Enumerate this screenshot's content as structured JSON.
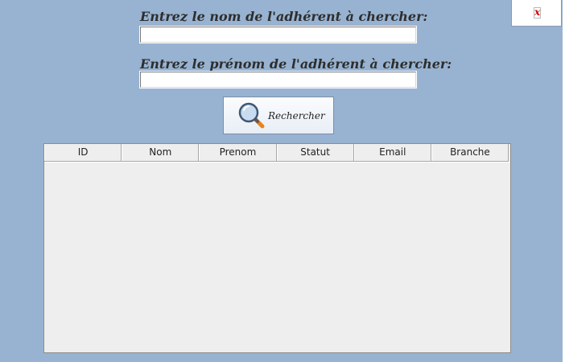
{
  "close_button": {
    "symbol": "x"
  },
  "search_form": {
    "last_name_label": "Entrez le nom de l'adhérent à chercher:",
    "last_name_value": "",
    "first_name_label": "Entrez le prénom de l'adhérent à chercher:",
    "first_name_value": "",
    "search_button_label": "Rechercher"
  },
  "results_table": {
    "columns": [
      "ID",
      "Nom",
      "Prenom",
      "Statut",
      "Email",
      "Branche"
    ],
    "rows": []
  },
  "colors": {
    "background": "#98b3d1",
    "label_text": "#2e2e2e",
    "close_icon": "#d40000",
    "table_background": "#eeeeee"
  }
}
